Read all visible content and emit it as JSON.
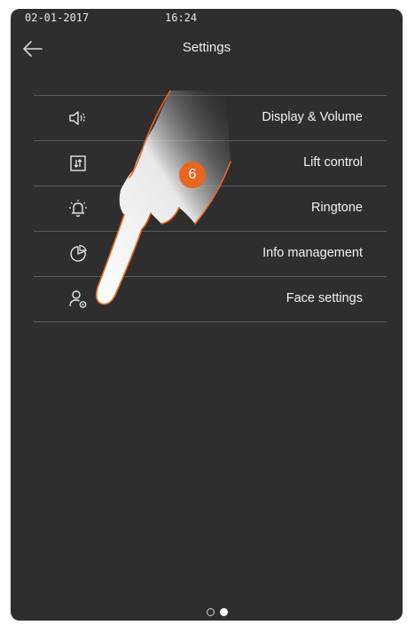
{
  "status": {
    "date": "02-01-2017",
    "time": "16:24"
  },
  "header": {
    "title": "Settings"
  },
  "menu": [
    {
      "label": "Display & Volume",
      "icon": "speaker-icon"
    },
    {
      "label": "Lift control",
      "icon": "lift-icon"
    },
    {
      "label": "Ringtone",
      "icon": "bell-icon"
    },
    {
      "label": "Info management",
      "icon": "info-chart-icon"
    },
    {
      "label": "Face settings",
      "icon": "face-settings-icon"
    }
  ],
  "callout": {
    "step": "6"
  },
  "pager": {
    "pages": 2,
    "current": 2
  },
  "colors": {
    "background": "#2e2e2e",
    "accent": "#e8661d",
    "text": "#f2f2f2",
    "divider": "#5a5a5a"
  }
}
